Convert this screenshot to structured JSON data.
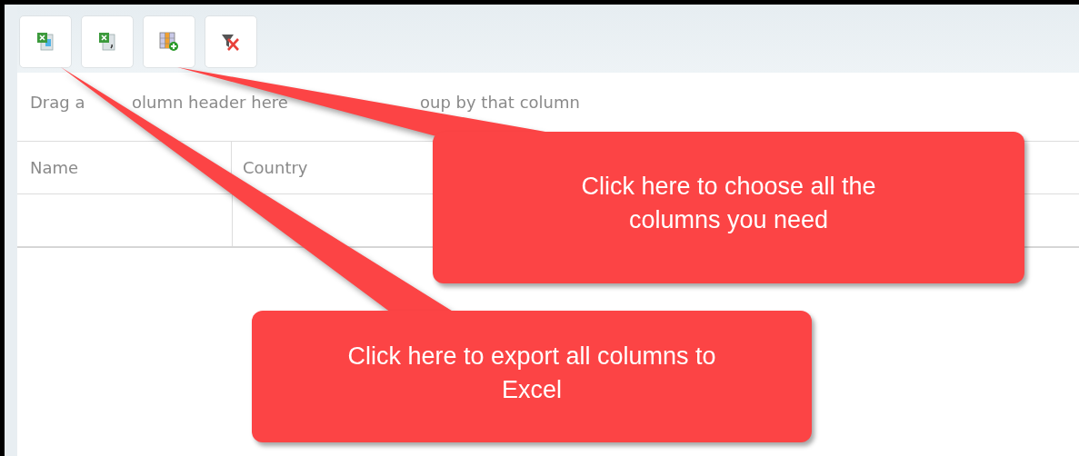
{
  "toolbar": {
    "buttons": [
      {
        "kind": "excel"
      },
      {
        "kind": "csv"
      },
      {
        "kind": "columns"
      },
      {
        "kind": "clear-filter"
      }
    ]
  },
  "group_panel": {
    "placeholder_visible_parts": [
      "Drag a",
      "olumn header here",
      "oup by that column"
    ]
  },
  "table": {
    "columns": [
      "Name",
      "Country"
    ]
  },
  "callouts": [
    {
      "text": "Click here to choose all the columns you need"
    },
    {
      "text": "Click here to export all columns to Excel"
    }
  ]
}
